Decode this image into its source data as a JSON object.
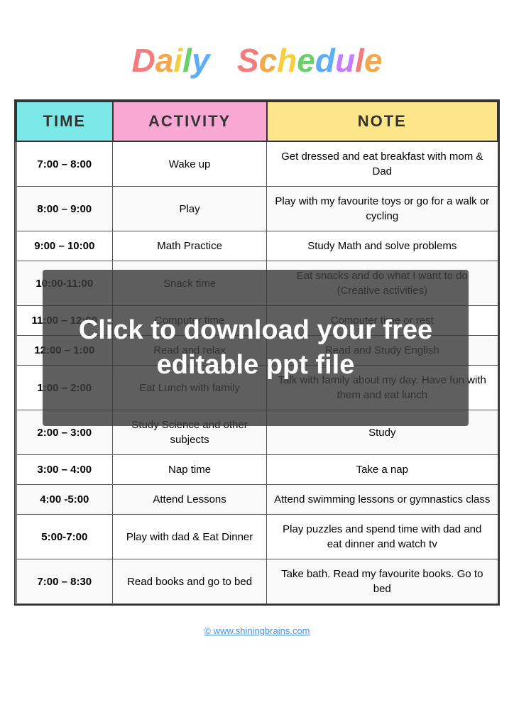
{
  "header": {
    "title_letters": [
      "D",
      "a",
      "i",
      "l",
      "y",
      " ",
      "S",
      "c",
      "h",
      "e",
      "d",
      "u",
      "l",
      "e"
    ],
    "title_full": "Daily Schedule"
  },
  "table": {
    "columns": [
      "TIME",
      "ACTIVITY",
      "NOTE"
    ],
    "rows": [
      {
        "time": "7:00 – 8:00",
        "activity": "Wake up",
        "note": "Get dressed and eat breakfast with mom & Dad"
      },
      {
        "time": "8:00 – 9:00",
        "activity": "Play",
        "note": "Play with my favourite toys or go for a walk or cycling"
      },
      {
        "time": "9:00 – 10:00",
        "activity": "Math Practice",
        "note": "Study Math and solve problems"
      },
      {
        "time": "10:00-11:00",
        "activity": "Snack time",
        "note": "Eat snacks and do what I want to do (Creative activities)"
      },
      {
        "time": "11:00 – 12:00",
        "activity": "Computer time",
        "note": "Computer time or rest"
      },
      {
        "time": "12:00 – 1:00",
        "activity": "Read and relax",
        "note": "Read and Study English"
      },
      {
        "time": "1:00 – 2:00",
        "activity": "Eat Lunch with family",
        "note": "Talk with family about my day. Have fun with them and eat lunch"
      },
      {
        "time": "2:00 – 3:00",
        "activity": "Study Science and other subjects",
        "note": "Study"
      },
      {
        "time": "3:00 – 4:00",
        "activity": "Nap time",
        "note": "Take a nap"
      },
      {
        "time": "4:00 -5:00",
        "activity": "Attend Lessons",
        "note": "Attend swimming lessons or gymnastics class"
      },
      {
        "time": "5:00-7:00",
        "activity": "Play with dad & Eat Dinner",
        "note": "Play puzzles and spend time with dad and eat dinner and watch tv"
      },
      {
        "time": "7:00 – 8:30",
        "activity": "Read books and go to bed",
        "note": "Take bath. Read my favourite books. Go to bed"
      }
    ]
  },
  "overlay": {
    "text": "Click to download your free editable ppt file"
  },
  "footer": {
    "url": "© www.shiningbrains.com"
  }
}
